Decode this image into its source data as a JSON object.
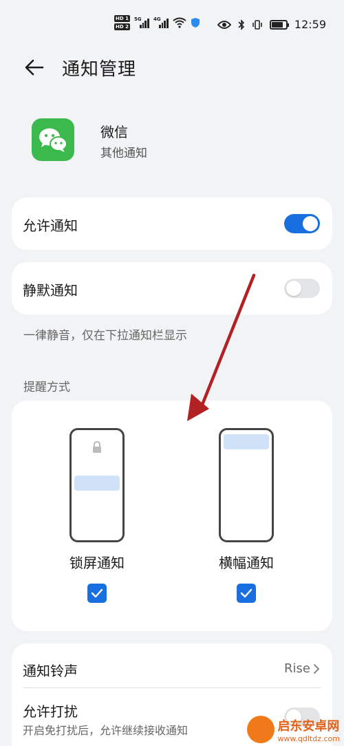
{
  "status_bar": {
    "hd1": "HD 1",
    "hd2": "HD 2",
    "sig1": "5G",
    "sig2": "4G",
    "time": "12:59"
  },
  "header": {
    "title": "通知管理"
  },
  "app": {
    "name": "微信",
    "subtitle": "其他通知"
  },
  "allow_notifications": {
    "label": "允许通知",
    "enabled": true
  },
  "silent_notifications": {
    "label": "静默通知",
    "enabled": false,
    "hint": "一律静音，仅在下拉通知栏显示"
  },
  "reminder": {
    "section_title": "提醒方式",
    "options": [
      {
        "label": "锁屏通知",
        "checked": true
      },
      {
        "label": "横幅通知",
        "checked": true
      }
    ]
  },
  "ringtone": {
    "label": "通知铃声",
    "value": "Rise"
  },
  "dnd": {
    "label": "允许打扰",
    "subtitle": "开启免打扰后，允许继续接收通知"
  },
  "watermark": {
    "name": "启东安卓网",
    "url": "www.qdltdz.com"
  },
  "colors": {
    "accent": "#1a6fe0",
    "app_green": "#3cb94d",
    "annotation_arrow": "#b22222"
  }
}
